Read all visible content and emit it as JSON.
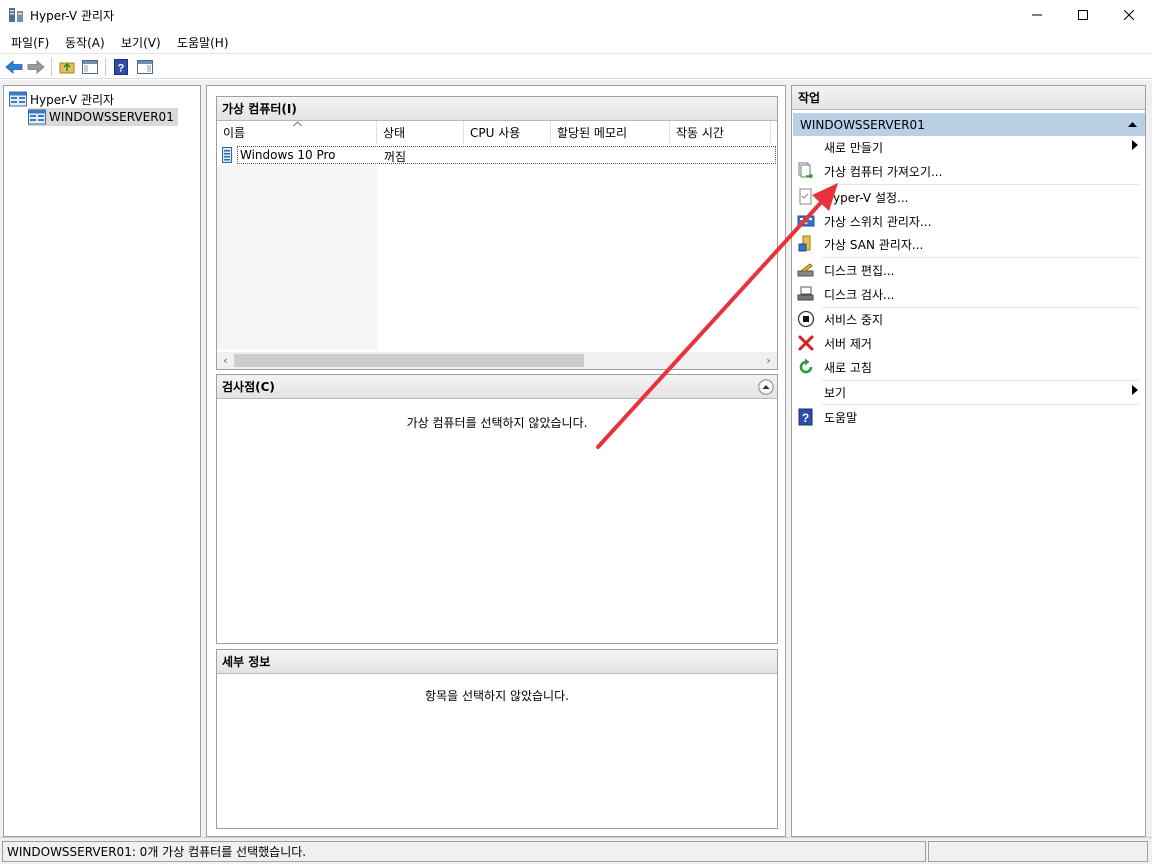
{
  "window": {
    "title": "Hyper-V 관리자"
  },
  "menu": {
    "items": [
      "파일(F)",
      "동작(A)",
      "보기(V)",
      "도움말(H)"
    ]
  },
  "tree": {
    "root": "Hyper-V 관리자",
    "server": "WINDOWSSERVER01"
  },
  "vm_panel": {
    "title": "가상 컴퓨터(I)",
    "columns": [
      "이름",
      "상태",
      "CPU 사용",
      "할당된 메모리",
      "작동 시간"
    ],
    "rows": [
      {
        "name": "Windows 10 Pro",
        "state": "꺼짐"
      }
    ]
  },
  "checkpoint_panel": {
    "title": "검사점(C)",
    "message": "가상 컴퓨터를 선택하지 않았습니다."
  },
  "details_panel": {
    "title": "세부 정보",
    "message": "항목을 선택하지 않았습니다."
  },
  "actions": {
    "title": "작업",
    "server": "WINDOWSSERVER01",
    "items": [
      {
        "label": "새로 만들기",
        "icon": "none"
      },
      {
        "label": "가상 컴퓨터 가져오기...",
        "icon": "import-icon"
      },
      {
        "label": "Hyper-V 설정...",
        "icon": "settings-doc-icon"
      },
      {
        "label": "가상 스위치 관리자...",
        "icon": "switch-icon"
      },
      {
        "label": "가상 SAN 관리자...",
        "icon": "san-icon"
      },
      {
        "label": "디스크 편집...",
        "icon": "edit-disk-icon"
      },
      {
        "label": "디스크 검사...",
        "icon": "inspect-disk-icon"
      },
      {
        "label": "서비스 중지",
        "icon": "stop-icon"
      },
      {
        "label": "서버 제거",
        "icon": "remove-icon"
      },
      {
        "label": "새로 고침",
        "icon": "refresh-icon"
      },
      {
        "label": "보기",
        "icon": "none"
      },
      {
        "label": "도움말",
        "icon": "help-icon"
      }
    ]
  },
  "status": {
    "text": "WINDOWSSERVER01:  0개 가상 컴퓨터를 선택했습니다."
  },
  "colors": {
    "selected_server_bg": "#b8cfe6",
    "annotation_arrow": "#e8323c"
  }
}
